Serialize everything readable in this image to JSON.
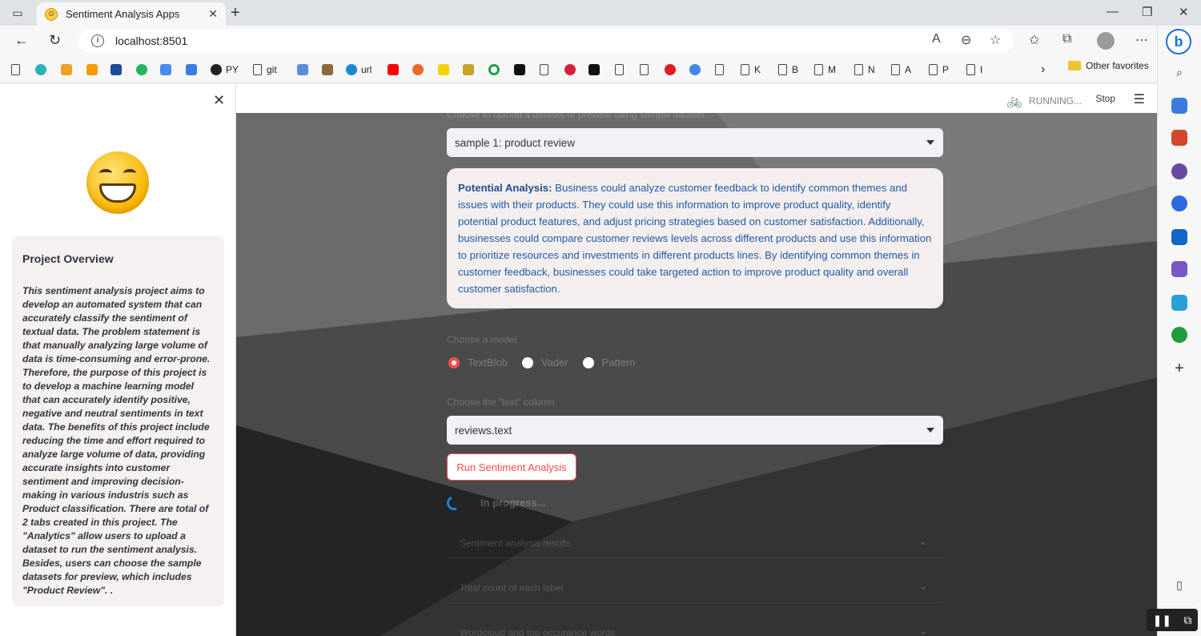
{
  "browser": {
    "tab_title": "Sentiment Analysis Apps",
    "url": "localhost:8501",
    "bookmarks": [
      "PY",
      "git",
      "url",
      "K",
      "B",
      "M",
      "N",
      "A",
      "P",
      "I"
    ],
    "other_favorites": "Other favorites"
  },
  "streamlit_header": {
    "running_label": "RUNNING...",
    "stop_label": "Stop"
  },
  "sidebar": {
    "overview_title": "Project Overview",
    "overview_text": "This sentiment analysis project aims to develop an automated system that can accurately classify the sentiment of textual data. The problem statement is that manually analyzing large volume of data is time-consuming and error-prone. Therefore, the purpose of this project is to develop a machine learning model that can accurately identify positive, negative and neutral sentiments in text data. The benefits of this project include reducing the time and effort required to analyze large volume of data, providing accurate insights into customer sentiment and improving decision-making in various industris such as Product classification. There are total of 2 tabs created in this project. The \"Analytics\" allow users to upload a dataset to run the sentiment analysis. Besides, users can choose the sample datasets for preview, which includes \"Product Review\". ."
  },
  "main": {
    "dataset_prompt": "Choose to upload a dataset or preview using sample dataset",
    "dataset_selected": "sample 1: product review",
    "analysis_label": "Potential Analysis:",
    "analysis_text": " Business could analyze customer feedback to identify common themes and issues with their products. They could use this information to improve product quality, identify potential product features, and adjust pricing strategies based on customer satisfaction. Additionally, businesses could compare customer reviews levels across different products and use this information to prioritize resources and investments in different products lines. By identifying common themes in customer feedback, businesses could take targeted action to improve product quality and overall customer satisfaction.",
    "model_prompt": "Choose a model",
    "models": [
      "TextBlob",
      "Vader",
      "Pattern"
    ],
    "selected_model": "TextBlob",
    "column_prompt": "Choose the \"text\" column",
    "column_selected": "reviews.text",
    "run_button": "Run Sentiment Analysis",
    "progress_text": "In progress...",
    "expanders": [
      "Sentiment analysis results",
      "Total count of each label",
      "Wordcloud and top occurance words"
    ]
  },
  "colors": {
    "accent": "#ff4b4b",
    "link_blue": "#1f5aa6",
    "spinner": "#1c83e1"
  }
}
